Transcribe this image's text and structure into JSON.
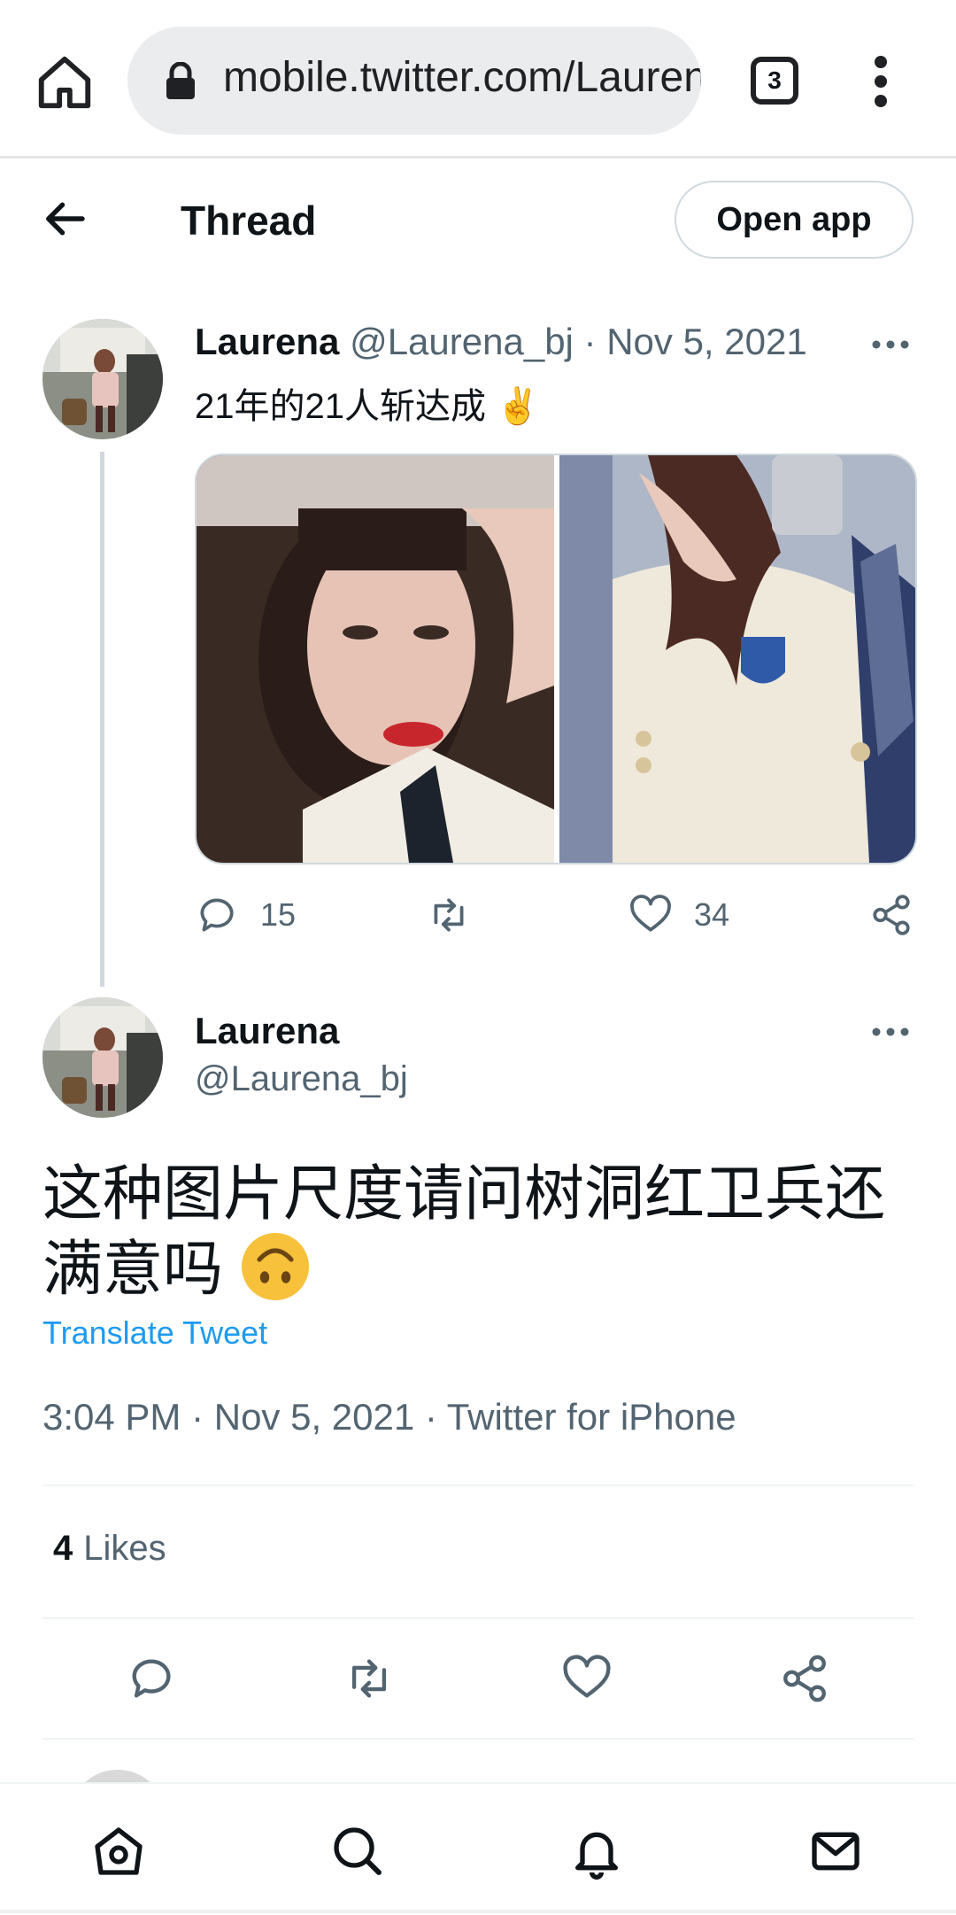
{
  "browser": {
    "url": "mobile.twitter.com/Laurena_bj",
    "tab_count": "3"
  },
  "header": {
    "title": "Thread",
    "open_app_label": "Open app"
  },
  "tweet1": {
    "name": "Laurena",
    "handle": "@Laurena_bj",
    "separator": " · ",
    "date": "Nov 5, 2021",
    "text": "21年的21人斩达成 ✌️",
    "replies": "15",
    "likes": "34"
  },
  "tweet2": {
    "name": "Laurena",
    "handle": "@Laurena_bj",
    "text": "这种图片尺度请问树洞红卫兵还满意吗",
    "translate_label": "Translate Tweet",
    "timestamp": "3:04 PM · Nov 5, 2021 · Twitter for iPhone",
    "likes_count": "4",
    "likes_label": "Likes"
  },
  "icons": {
    "home": "home-icon",
    "lock": "lock-icon",
    "menu": "more-vertical-icon",
    "back": "arrow-left-icon",
    "reply": "reply-icon",
    "retweet": "retweet-icon",
    "like": "heart-icon",
    "share": "share-icon",
    "nav_home": "home-nav-icon",
    "nav_search": "search-icon",
    "nav_notifications": "bell-icon",
    "nav_messages": "mail-icon"
  },
  "colors": {
    "link": "#1d9bf0",
    "muted": "#536471",
    "text": "#0f1419",
    "border": "#cfd9de"
  }
}
